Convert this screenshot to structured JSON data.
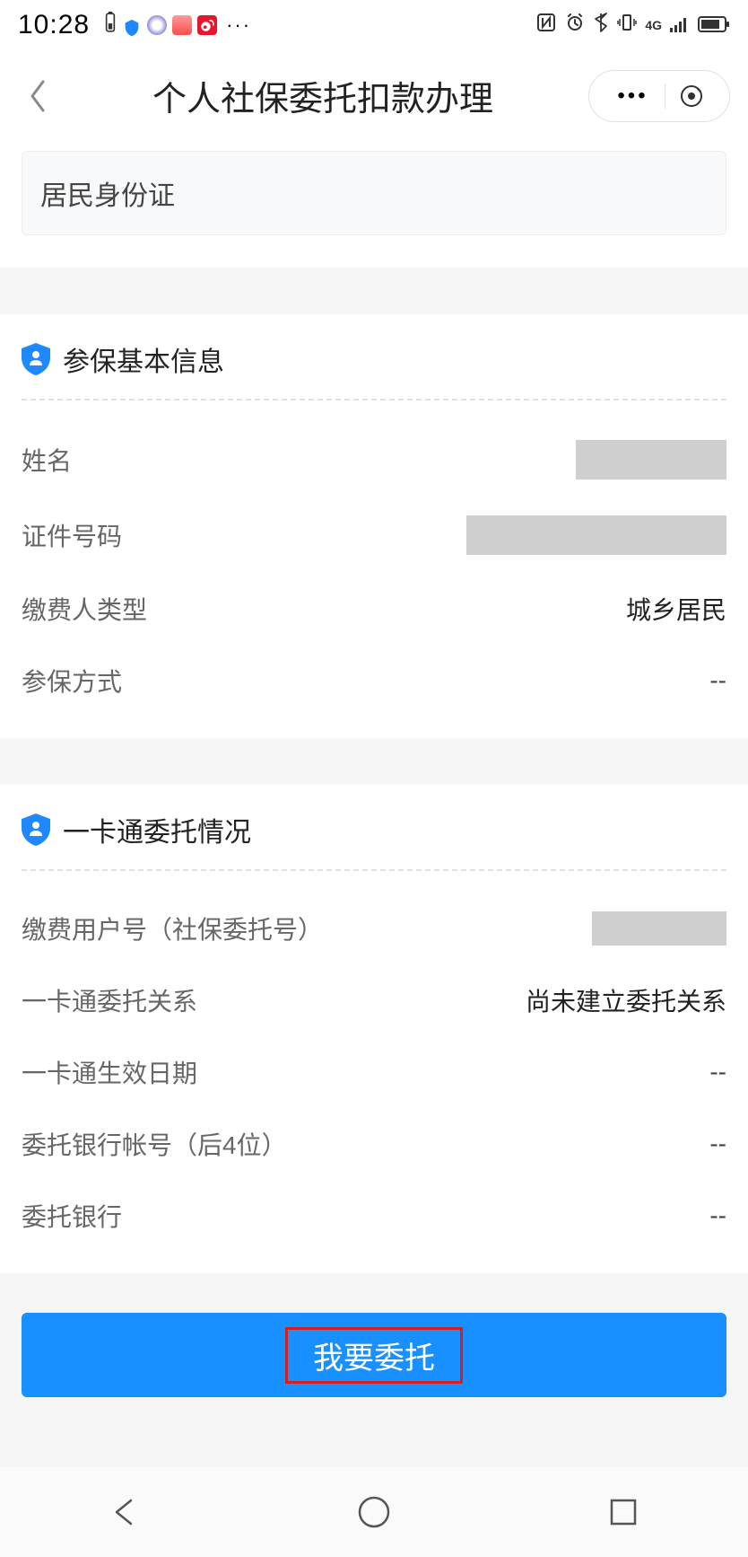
{
  "statusBar": {
    "time": "10:28"
  },
  "nav": {
    "title": "个人社保委托扣款办理"
  },
  "idCard": {
    "selectedType": "居民身份证"
  },
  "basicInfo": {
    "title": "参保基本信息",
    "fields": {
      "nameLabel": "姓名",
      "idNumberLabel": "证件号码",
      "payerTypeLabel": "缴费人类型",
      "payerTypeValue": "城乡居民",
      "insuranceMethodLabel": "参保方式",
      "insuranceMethodValue": "--"
    }
  },
  "entrust": {
    "title": "一卡通委托情况",
    "fields": {
      "userNoLabel": "缴费用户号（社保委托号）",
      "relationLabel": "一卡通委托关系",
      "relationValue": "尚未建立委托关系",
      "effectiveDateLabel": "一卡通生效日期",
      "effectiveDateValue": "--",
      "bankAccountLabel": "委托银行帐号（后4位）",
      "bankAccountValue": "--",
      "bankLabel": "委托银行",
      "bankValue": "--"
    }
  },
  "action": {
    "primaryButton": "我要委托"
  }
}
